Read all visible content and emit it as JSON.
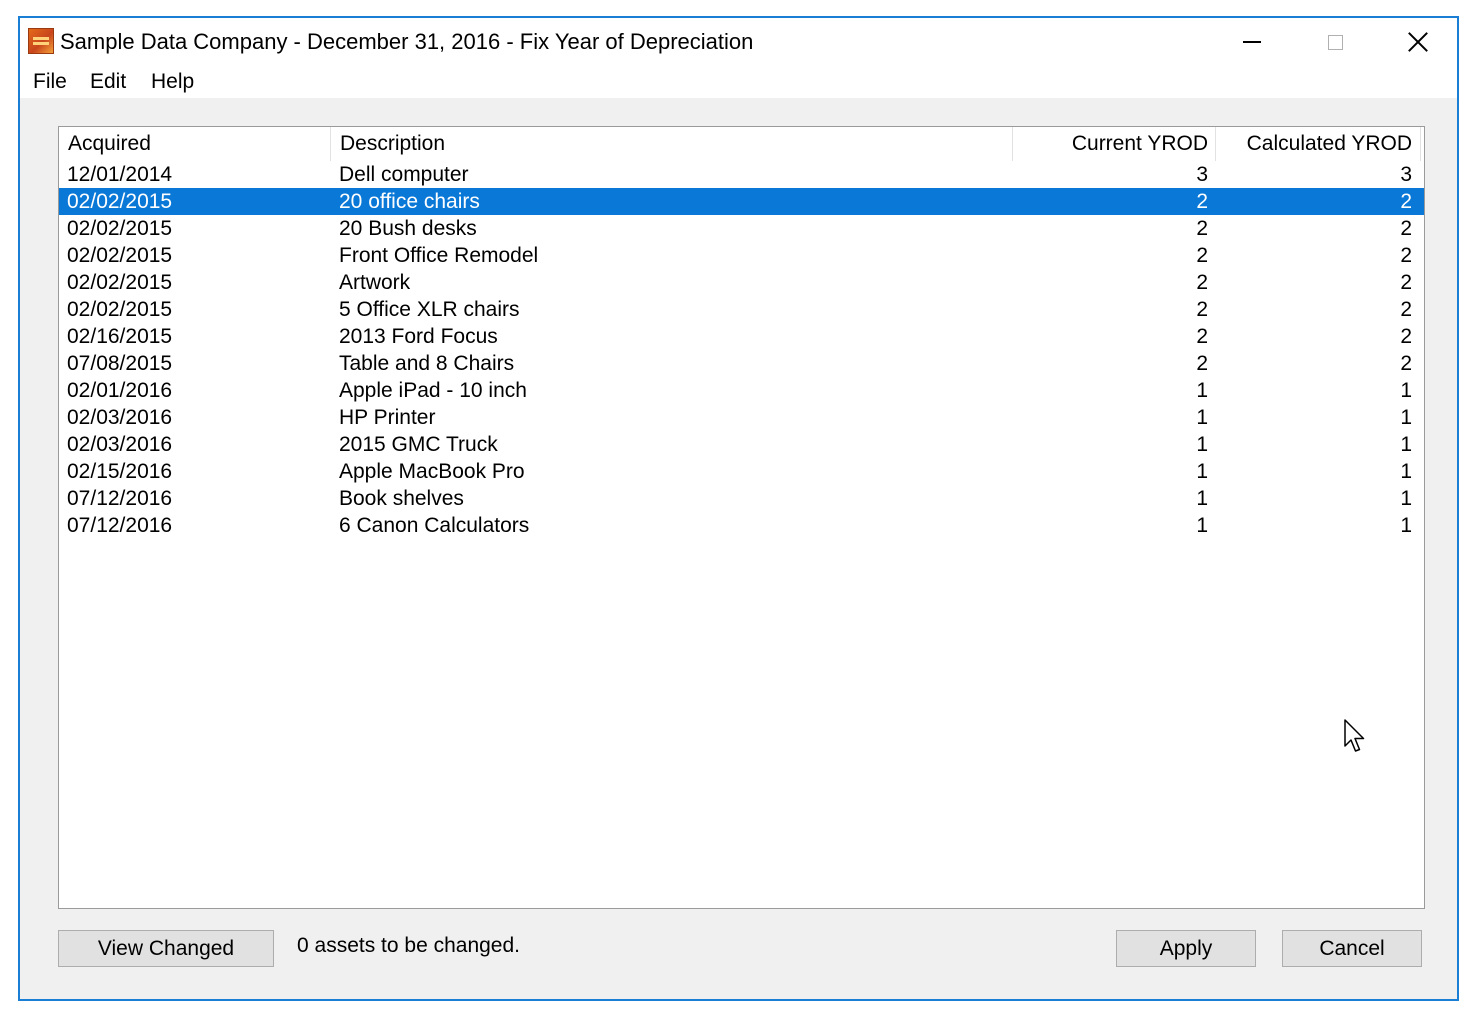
{
  "window": {
    "title": "Sample Data Company  -  December 31, 2016  -  Fix Year of Depreciation"
  },
  "menu": {
    "file": "File",
    "edit": "Edit",
    "help": "Help"
  },
  "table": {
    "headers": {
      "acquired": "Acquired",
      "description": "Description",
      "current": "Current YROD",
      "calculated": "Calculated YROD"
    },
    "rows": [
      {
        "acquired": "12/01/2014",
        "description": "Dell computer",
        "current": "3",
        "calculated": "3"
      },
      {
        "acquired": "02/02/2015",
        "description": "20 office chairs",
        "current": "2",
        "calculated": "2"
      },
      {
        "acquired": "02/02/2015",
        "description": "20 Bush desks",
        "current": "2",
        "calculated": "2"
      },
      {
        "acquired": "02/02/2015",
        "description": "Front Office Remodel",
        "current": "2",
        "calculated": "2"
      },
      {
        "acquired": "02/02/2015",
        "description": "Artwork",
        "current": "2",
        "calculated": "2"
      },
      {
        "acquired": "02/02/2015",
        "description": "5 Office XLR chairs",
        "current": "2",
        "calculated": "2"
      },
      {
        "acquired": "02/16/2015",
        "description": "2013 Ford Focus",
        "current": "2",
        "calculated": "2"
      },
      {
        "acquired": "07/08/2015",
        "description": "Table and 8 Chairs",
        "current": "2",
        "calculated": "2"
      },
      {
        "acquired": "02/01/2016",
        "description": "Apple iPad - 10 inch",
        "current": "1",
        "calculated": "1"
      },
      {
        "acquired": "02/03/2016",
        "description": "HP Printer",
        "current": "1",
        "calculated": "1"
      },
      {
        "acquired": "02/03/2016",
        "description": "2015 GMC Truck",
        "current": "1",
        "calculated": "1"
      },
      {
        "acquired": "02/15/2016",
        "description": "Apple MacBook Pro",
        "current": "1",
        "calculated": "1"
      },
      {
        "acquired": "07/12/2016",
        "description": "Book shelves",
        "current": "1",
        "calculated": "1"
      },
      {
        "acquired": "07/12/2016",
        "description": "6 Canon Calculators",
        "current": "1",
        "calculated": "1"
      }
    ]
  },
  "footer": {
    "view_changed": "View Changed",
    "status": "0 assets to be changed.",
    "apply": "Apply",
    "cancel": "Cancel"
  },
  "colors": {
    "selection": "#0a78d7",
    "window_border": "#1a7fd4"
  }
}
